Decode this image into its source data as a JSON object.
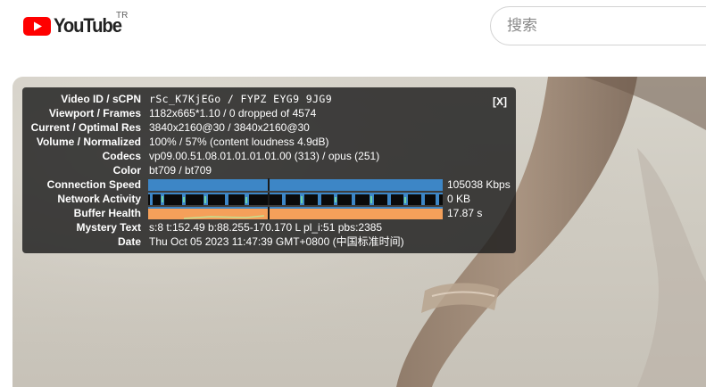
{
  "header": {
    "logo_text": "YouTube",
    "country_code": "TR",
    "search": {
      "placeholder": "搜索",
      "value": ""
    },
    "colors": {
      "brand_red": "#ff0000"
    }
  },
  "stats_panel": {
    "close_label": "[X]",
    "rows": [
      {
        "label": "Video ID / sCPN",
        "value": "rSc_K7KjEGo / FYPZ EYG9 9JG9"
      },
      {
        "label": "Viewport / Frames",
        "value": "1182x665*1.10 / 0 dropped of 4574"
      },
      {
        "label": "Current / Optimal Res",
        "value": "3840x2160@30 / 3840x2160@30"
      },
      {
        "label": "Volume / Normalized",
        "value": "100% / 57% (content loudness 4.9dB)"
      },
      {
        "label": "Codecs",
        "value": "vp09.00.51.08.01.01.01.01.00 (313) / opus (251)"
      },
      {
        "label": "Color",
        "value": "bt709 / bt709"
      }
    ],
    "graphs": [
      {
        "label": "Connection Speed",
        "value": "105038 Kbps",
        "color": "#3d86c6"
      },
      {
        "label": "Network Activity",
        "value": "0 KB",
        "color": "#3d86c6"
      },
      {
        "label": "Buffer Health",
        "value": "17.87 s",
        "color": "#f5a05a"
      }
    ],
    "rows_after": [
      {
        "label": "Mystery Text",
        "value": "s:8 t:152.49 b:88.255-170.170 L pl_i:51 pbs:2385"
      },
      {
        "label": "Date",
        "value": "Thu Oct 05 2023 11:47:39 GMT+0800 (中国标准时间)"
      }
    ]
  }
}
